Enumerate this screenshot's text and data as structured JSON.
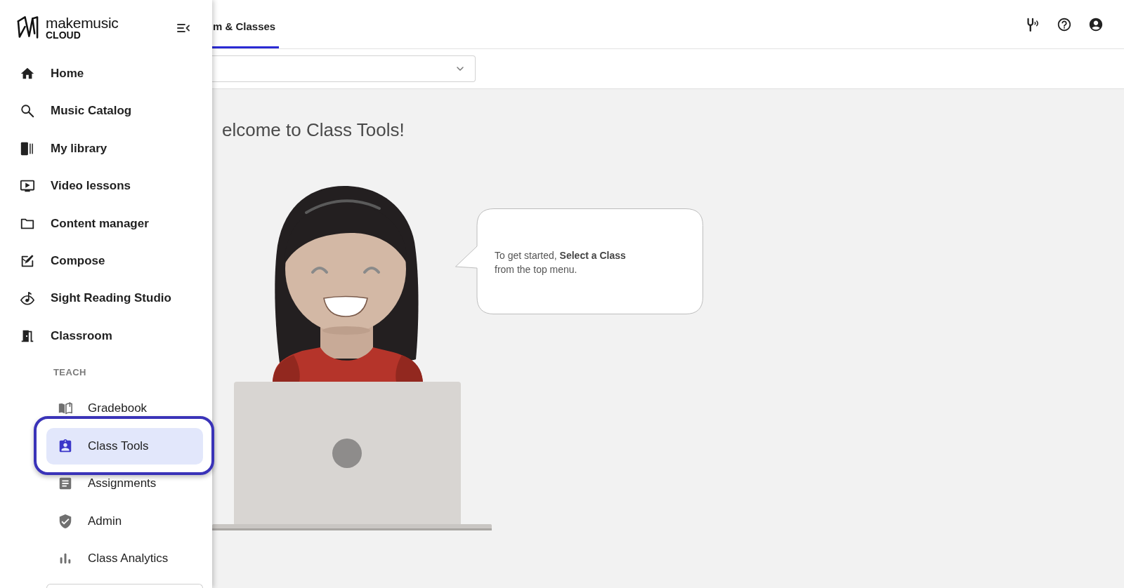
{
  "sidebar": {
    "logo": {
      "wordmark": "makemusic",
      "subtitle": "CLOUD"
    },
    "items": [
      {
        "label": "Home",
        "selected": false
      },
      {
        "label": "Music Catalog",
        "selected": false
      },
      {
        "label": "My library",
        "selected": false
      },
      {
        "label": "Video lessons",
        "selected": false
      },
      {
        "label": "Content manager",
        "selected": false
      },
      {
        "label": "Compose",
        "selected": false
      },
      {
        "label": "Sight Reading Studio",
        "selected": false
      },
      {
        "label": "Classroom",
        "selected": false
      }
    ],
    "section": {
      "title": "TEACH",
      "items": [
        {
          "label": "Gradebook",
          "selected": false,
          "highlighted": false
        },
        {
          "label": "Class Tools",
          "selected": true,
          "highlighted": true
        },
        {
          "label": "Assignments",
          "selected": false,
          "highlighted": false
        },
        {
          "label": "Admin",
          "selected": false,
          "highlighted": false
        },
        {
          "label": "Class Analytics",
          "selected": false,
          "highlighted": false
        }
      ]
    }
  },
  "topbar": {
    "tabs": [
      {
        "label": "m & Classes",
        "selected": true
      }
    ]
  },
  "class_select": {
    "expanded": false
  },
  "welcome": {
    "title": "elcome to Class Tools!",
    "bubble_lines": [
      "To get started, **Select a Class**",
      "from the top menu."
    ]
  }
}
